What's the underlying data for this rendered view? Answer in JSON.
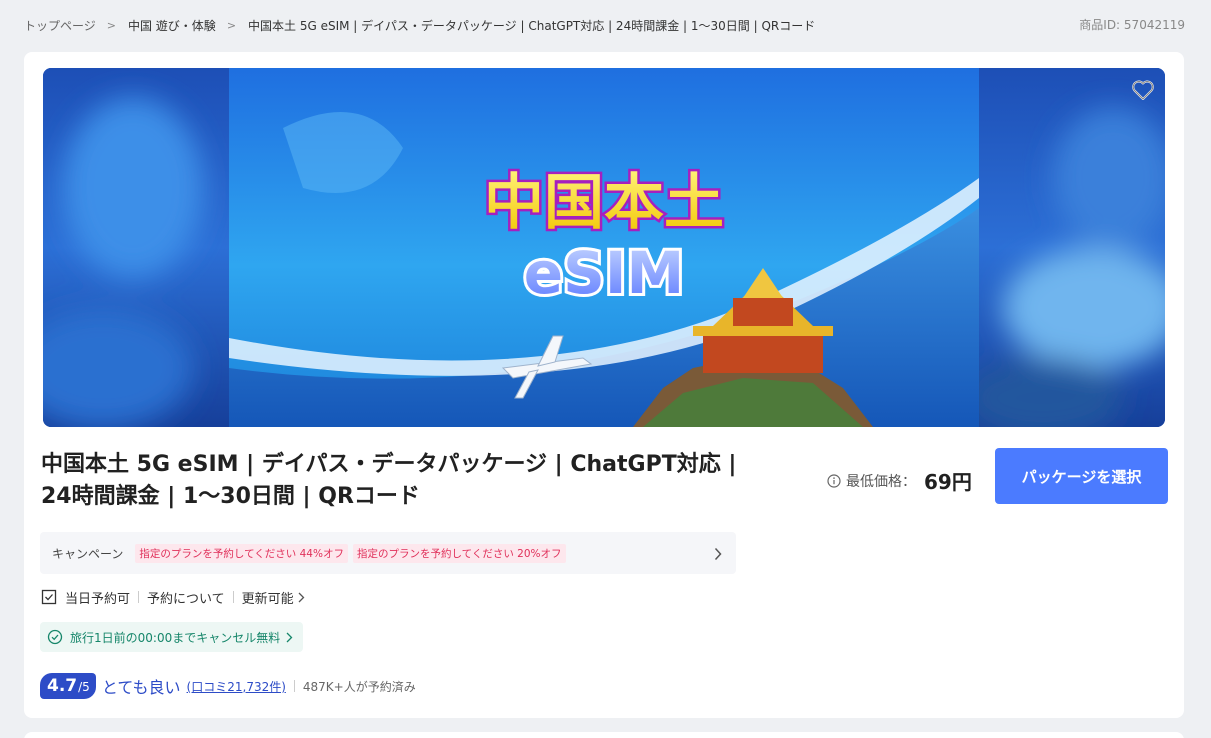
{
  "breadcrumb": {
    "items": [
      "トップページ",
      "中国 遊び・体験",
      "中国本土 5G eSIM | デイパス・データパッケージ | ChatGPT対応 | 24時間課金 | 1〜30日間 | QRコード"
    ],
    "product_id": "商品ID: 57042119"
  },
  "hero": {
    "title_line1": "中国本土",
    "title_line2": "eSIM",
    "favorite_icon": "heart-outline-icon"
  },
  "product": {
    "title": "中国本土 5G eSIM | デイパス・データパッケージ | ChatGPT対応 | 24時間課金 | 1〜30日間 | QRコード",
    "price_label": "最低価格：",
    "price_value": "69円",
    "select_button": "パッケージを選択"
  },
  "campaign": {
    "label": "キャンペーン",
    "tags": [
      "指定のプランを予約してください 44%オフ",
      "指定のプランを予約してください 20%オフ"
    ]
  },
  "features": {
    "same_day": "当日予約可",
    "about_booking": "予約について",
    "renewable": "更新可能"
  },
  "cancellation": {
    "text": "旅行1日前の00:00までキャンセル無料"
  },
  "rating": {
    "score": "4.7",
    "max": "/5",
    "label": "とても良い",
    "reviews": "(口コミ21,732件)",
    "booked": "487K+人が予約済み"
  },
  "colors": {
    "accent": "#4b7bff",
    "rating": "#2d4cc7",
    "tag_text": "#e0305a",
    "cancel_green": "#16866a"
  }
}
